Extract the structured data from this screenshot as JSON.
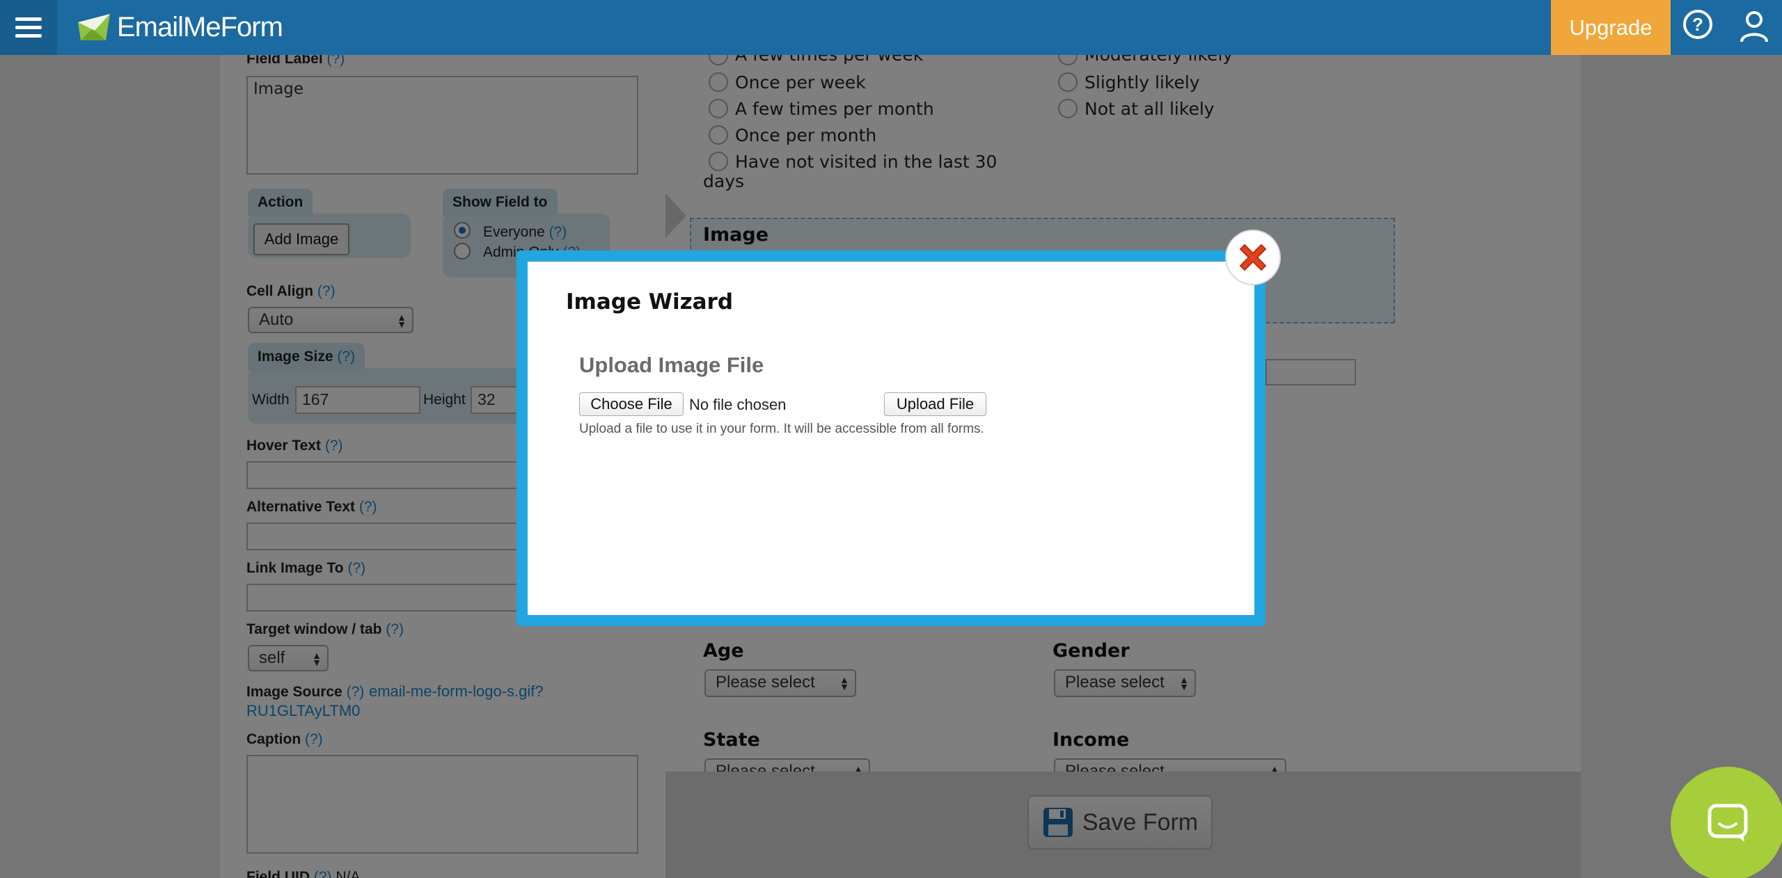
{
  "topbar": {
    "logo_text": "EmailMeForm",
    "upgrade_label": "Upgrade",
    "help_glyph": "?",
    "brand_color": "#1b6aa1",
    "upgrade_color": "#f0a63a"
  },
  "editor": {
    "field_label_label": "Field Label",
    "help_mark": "(?)",
    "field_label_value": "Image",
    "action_tab": "Action",
    "add_image_button": "Add Image",
    "show_field_tab": "Show Field to",
    "everyone_option": "Everyone",
    "admin_only_option": "Admin Only",
    "cell_align_label": "Cell Align",
    "cell_align_value": "Auto",
    "image_size_tab": "Image Size",
    "width_label": "Width",
    "width_value": "167",
    "height_label": "Height",
    "height_value": "32",
    "hover_text_label": "Hover Text",
    "alt_text_label": "Alternative Text",
    "link_image_label": "Link Image To",
    "target_window_label": "Target window / tab",
    "target_window_value": "self",
    "image_source_label": "Image Source",
    "image_source_link_1": "email-me-form-logo-s.gif?",
    "image_source_link_2": "RU1GLTAyLTM0",
    "caption_label": "Caption",
    "field_uid_label": "Field UID",
    "field_uid_value": "N/A"
  },
  "form": {
    "visits_options": [
      "A few times per week",
      "Once per week",
      "A few times per month",
      "Once per month",
      "Have not visited in the last 30",
      "days"
    ],
    "likely_options": [
      "Moderately likely",
      "Slightly likely",
      "Not at all likely"
    ],
    "image_field_title": "Image",
    "age_label": "Age",
    "gender_label": "Gender",
    "state_label": "State",
    "income_label": "Income",
    "select_placeholder": "Please select",
    "save_button": "Save Form"
  },
  "modal": {
    "title": "Image Wizard",
    "upload_heading": "Upload Image File",
    "choose_file_button": "Choose File",
    "no_file_text": "No file chosen",
    "upload_file_button": "Upload File",
    "help_text": "Upload a file to use it in your form. It will be accessible from all forms.",
    "frame_color": "#21a6e1"
  },
  "chat": {
    "color": "#a6cd3a"
  }
}
